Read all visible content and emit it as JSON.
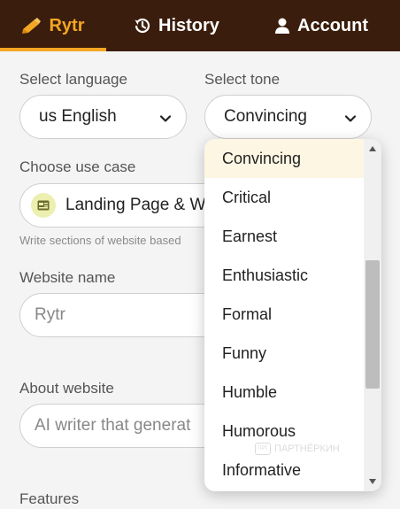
{
  "nav": {
    "tabs": [
      {
        "label": "Rytr",
        "icon": "rytr-logo-icon",
        "active": true
      },
      {
        "label": "History",
        "icon": "history-icon"
      },
      {
        "label": "Account",
        "icon": "user-icon"
      }
    ]
  },
  "form": {
    "language": {
      "label": "Select language",
      "value": "us English"
    },
    "tone": {
      "label": "Select tone",
      "value": "Convincing"
    },
    "use_case": {
      "label": "Choose use case",
      "value": "Landing Page & W",
      "hint": "Write sections of website based"
    },
    "website_name": {
      "label": "Website name",
      "placeholder": "Rytr"
    },
    "about_website": {
      "label": "About website",
      "placeholder": "AI writer that generat"
    },
    "features": {
      "label": "Features"
    }
  },
  "tone_dropdown": {
    "options": [
      "Convincing",
      "Critical",
      "Earnest",
      "Enthusiastic",
      "Formal",
      "Funny",
      "Humble",
      "Humorous",
      "Informative"
    ],
    "selected": "Convincing"
  },
  "watermark": {
    "text": "ПАРТНЁРКИН"
  },
  "colors": {
    "topbar": "#3a1d0c",
    "accent": "#f5a623",
    "selected_option_bg": "#fdf6e3"
  }
}
